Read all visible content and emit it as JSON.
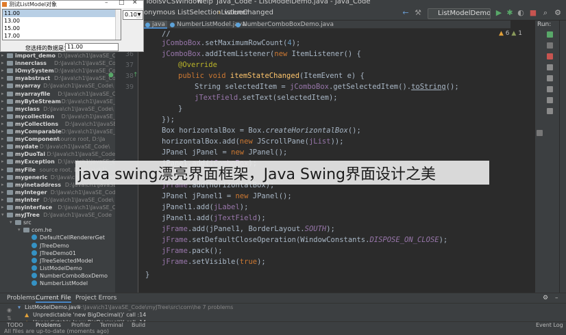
{
  "menubar": {
    "items": [
      "Tools",
      "VCS",
      "Window",
      "Help"
    ],
    "title": "Java_Code - ListModelDemo.java - Java_Code"
  },
  "toolbar": {
    "crumb1": "onymous ListSelectionListener",
    "crumb2": "valueChanged",
    "run_config": "ListModelDemo"
  },
  "editor_tabs": [
    {
      "label": "java",
      "active": true
    },
    {
      "label": "NumberListModel.java",
      "active": false
    },
    {
      "label": "NumberComboBoxDemo.java",
      "active": false
    }
  ],
  "inspection": {
    "warnings": "6",
    "weak": "1"
  },
  "run_panel": {
    "label": "Run:"
  },
  "project_tree": [
    {
      "name": "import_demo",
      "path": "D:\\Java\\ch1\\JavaSE_Cod",
      "bold": true
    },
    {
      "name": "innerclass",
      "path": "D:\\Java\\ch1\\JavaSE_Code",
      "bold": true
    },
    {
      "name": "IOmySystem",
      "path": "D:\\Java\\ch1\\JavaSE_Co",
      "bold": true
    },
    {
      "name": "myabstract",
      "path": "D:\\Java\\ch1\\JavaSE_Code",
      "bold": true
    },
    {
      "name": "myarray",
      "path": "D:\\Java\\ch1\\JavaSE_Code\\",
      "bold": true
    },
    {
      "name": "myarrayfile",
      "path": "D:\\Java\\ch1\\JavaSE_Code",
      "bold": true
    },
    {
      "name": "myByteStream",
      "path": "D:\\Java\\ch1\\JavaSE_",
      "bold": true
    },
    {
      "name": "myclass",
      "path": "D:\\Java\\ch1\\JavaSE_Code\\",
      "bold": true
    },
    {
      "name": "mycollection",
      "path": "D:\\Java\\ch1\\JavaSE_Co",
      "bold": true
    },
    {
      "name": "myCollections",
      "path": "D:\\Java\\ch1\\JavaSE",
      "bold": true
    },
    {
      "name": "myComparable",
      "path": "D:\\Java\\ch1\\JavaSE_",
      "bold": true
    },
    {
      "name": "myComponent",
      "path": "source root, D:\\Ja",
      "bold": true
    },
    {
      "name": "mydate",
      "path": "D:\\Java\\ch1\\JavaSE_Code\\",
      "bold": true
    },
    {
      "name": "myDuoTai",
      "path": "D:\\Java\\ch1\\JavaSE_Code",
      "bold": true
    },
    {
      "name": "myException",
      "path": "D:\\Java\\ch1\\JavaSE_C",
      "bold": true
    },
    {
      "name": "myFile",
      "path": "source root, D:\\Java\\ch1\\",
      "bold": true
    },
    {
      "name": "mygeneric",
      "path": "D:\\Java\\ch1\\JavaSE_Cod",
      "bold": true
    },
    {
      "name": "myinetaddress",
      "path": "D:\\Java\\ch1\\JavaSE_",
      "bold": true
    },
    {
      "name": "myInteger",
      "path": "D:\\Java\\ch1\\JavaSE_Cod",
      "bold": true
    },
    {
      "name": "myInter",
      "path": "D:\\Java\\ch1\\JavaSE_Code\\",
      "bold": true
    },
    {
      "name": "myinterface",
      "path": "D:\\Java\\ch1\\JavaSE_Co",
      "bold": true
    },
    {
      "name": "myJTree",
      "path": "D:\\Java\\ch1\\JavaSE_Code",
      "bold": true
    },
    {
      "name": "src",
      "path": "",
      "bold": false
    },
    {
      "name": "com.he",
      "path": "",
      "bold": false
    },
    {
      "name": "DefaultCellRendererGet",
      "path": "",
      "bold": false
    },
    {
      "name": "JTreeDemo",
      "path": "",
      "bold": false
    },
    {
      "name": "JTreeDemo01",
      "path": "",
      "bold": false
    },
    {
      "name": "JTreeSelectedModel",
      "path": "",
      "bold": false
    },
    {
      "name": "ListModelDemo",
      "path": "",
      "bold": false
    },
    {
      "name": "NumberComboBoxDemo",
      "path": "",
      "bold": false
    },
    {
      "name": "NumberListModel",
      "path": "",
      "bold": false
    }
  ],
  "line_numbers": [
    "36",
    "37",
    "38",
    "39",
    "40"
  ],
  "code_lines": [
    "//",
    "jComboBox.setMaximumRowCount(4);",
    "jComboBox.addItemListener(new ItemListener() {",
    "@Override",
    "public void itemStateChanged(ItemEvent e) {",
    "String selectedItem = jComboBox.getSelectedItem().toString();",
    "jTextField.setText(selectedItem);",
    "}",
    "});",
    "Box horizontalBox = Box.createHorizontalBox();",
    "horizontalBox.add(new JScrollPane(jList));",
    "JPanel jPanel = new JPanel();",
    "jPanel.add(jComboBox);",
    "jFrame.add(horizontalBox);",
    "JPanel jPanel1 = new JPanel();",
    "jPanel1.add(jLabel);",
    "jPanel1.add(jTextField);",
    "jFrame.add(jPanel1, BorderLayout.SOUTH);",
    "jFrame.setDefaultCloseOperation(WindowConstants.DISPOSE_ON_CLOSE);",
    "jFrame.pack();",
    "jFrame.setVisible(true);",
    "}"
  ],
  "swing_window": {
    "title": "测试ListModel对象",
    "list_items": [
      "11.00",
      "13.00",
      "15.00",
      "17.00"
    ],
    "combo_value": "0.10",
    "label": "您选择的数据是：",
    "field_value": "11.00"
  },
  "problems": {
    "tabs": [
      "Problems:",
      "Current File",
      "Project Errors"
    ],
    "file_row": "ListModelDemo.java",
    "file_path": "D:\\Java\\ch1\\JavaSE_Code\\myJTree\\src\\com\\he  7 problems",
    "row1": "Unpredictable 'new BigDecimal()' call :14",
    "row2": "Unpredictable 'new BigDecimal()' call :14"
  },
  "status_tabs": [
    "TODO",
    "Problems",
    "Profiler",
    "Terminal",
    "Build"
  ],
  "event_log": "Event Log",
  "status_line": "All files are up-to-date (moments ago)",
  "caption": "java swing漂亮界面框架，Java Swing界面设计之美"
}
